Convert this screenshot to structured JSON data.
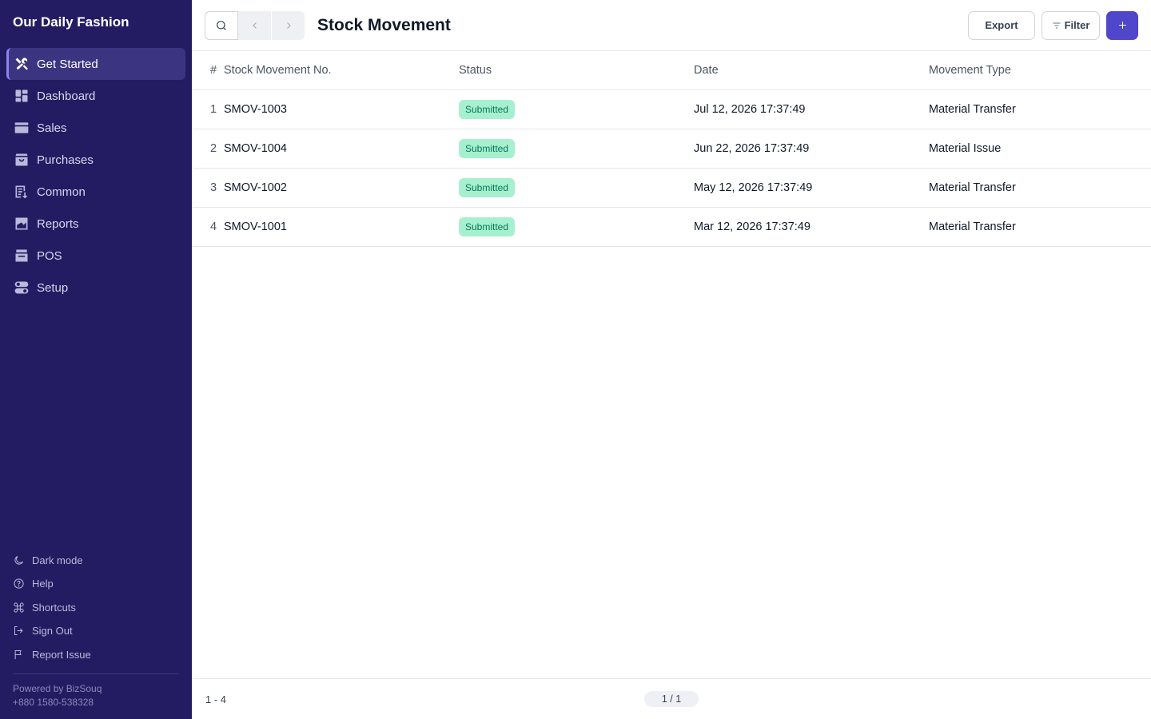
{
  "app": {
    "title": "Our Daily Fashion"
  },
  "sidebar": {
    "items": [
      {
        "label": "Get Started",
        "icon": "tools-icon",
        "active": true
      },
      {
        "label": "Dashboard",
        "icon": "dashboard-icon"
      },
      {
        "label": "Sales",
        "icon": "sales-icon"
      },
      {
        "label": "Purchases",
        "icon": "purchases-icon"
      },
      {
        "label": "Common",
        "icon": "common-icon"
      },
      {
        "label": "Reports",
        "icon": "reports-icon"
      },
      {
        "label": "POS",
        "icon": "pos-icon"
      },
      {
        "label": "Setup",
        "icon": "setup-icon"
      }
    ],
    "bottom": [
      {
        "label": "Dark mode",
        "icon": "moon-icon"
      },
      {
        "label": "Help",
        "icon": "help-icon"
      },
      {
        "label": "Shortcuts",
        "icon": "command-icon"
      },
      {
        "label": "Sign Out",
        "icon": "sign-out-icon"
      },
      {
        "label": "Report Issue",
        "icon": "flag-icon"
      }
    ],
    "powered_by": "Powered by BizSouq",
    "phone": "+880 1580-538328"
  },
  "header": {
    "title": "Stock Movement",
    "export_label": "Export",
    "filter_label": "Filter"
  },
  "table": {
    "columns": {
      "num": "#",
      "no": "Stock Movement No.",
      "status": "Status",
      "date": "Date",
      "type": "Movement Type"
    },
    "rows": [
      {
        "num": "1",
        "no": "SMOV-1003",
        "status": "Submitted",
        "date": "Jul 12, 2026 17:37:49",
        "type": "Material Transfer"
      },
      {
        "num": "2",
        "no": "SMOV-1004",
        "status": "Submitted",
        "date": "Jun 22, 2026 17:37:49",
        "type": "Material Issue"
      },
      {
        "num": "3",
        "no": "SMOV-1002",
        "status": "Submitted",
        "date": "May 12, 2026 17:37:49",
        "type": "Material Transfer"
      },
      {
        "num": "4",
        "no": "SMOV-1001",
        "status": "Submitted",
        "date": "Mar 12, 2026 17:37:49",
        "type": "Material Transfer"
      }
    ]
  },
  "footer": {
    "range": "1 - 4",
    "page": "1 / 1"
  },
  "colors": {
    "sidebar_bg": "#241c62",
    "accent": "#4f46cc",
    "badge_bg": "#a7f0cf",
    "badge_text": "#047857"
  }
}
